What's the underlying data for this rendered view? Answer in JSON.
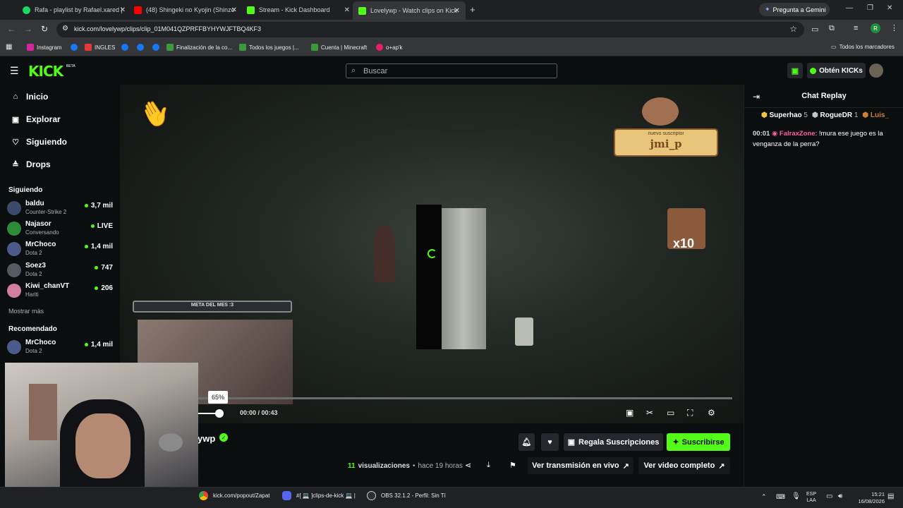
{
  "browser": {
    "tabs": [
      {
        "title": "Rafa - playlist by Rafael.xared |",
        "color": "#1ed760"
      },
      {
        "title": "(48) Shingeki no Kyojin (Shinzo",
        "color": "#ff0000"
      },
      {
        "title": "Stream - Kick Dashboard",
        "color": "#53fc18"
      },
      {
        "title": "Lovelywp - Watch clips on Kick",
        "color": "#53fc18"
      }
    ],
    "gemini_label": "Pregunta a Gemini",
    "url": "kick.com/lovelywp/clips/clip_01M041QZPRFFBYHYWJFTBQ4KF3",
    "bookmarks": [
      "Instagram",
      "",
      "INGLES",
      "",
      "",
      "",
      "Finalización de la co...",
      "Todos los juegos |...",
      "Cuenta | Minecraft",
      "o+ap'k"
    ],
    "all_bookmarks": "Todos los marcadores"
  },
  "header": {
    "logo": "KICK",
    "beta": "BETA",
    "search_placeholder": "Buscar",
    "get_kicks": "Obtén KICKs"
  },
  "sidebar": {
    "nav": [
      {
        "label": "Inicio",
        "icon": "⌂"
      },
      {
        "label": "Explorar",
        "icon": "▣"
      },
      {
        "label": "Siguiendo",
        "icon": "♡"
      },
      {
        "label": "Drops",
        "icon": "≜"
      }
    ],
    "following_title": "Siguiendo",
    "following": [
      {
        "name": "baldu",
        "game": "Counter-Strike 2",
        "viewers": "3,7 mil",
        "color": "#3b4a6b"
      },
      {
        "name": "Najasor",
        "game": "Conversando",
        "viewers": "LIVE",
        "color": "#2e8b3a"
      },
      {
        "name": "MrChoco",
        "game": "Dota 2",
        "viewers": "1,4 mil",
        "color": "#4a5a8a"
      },
      {
        "name": "Soez3",
        "game": "Dota 2",
        "viewers": "747",
        "color": "#555a60"
      },
      {
        "name": "Kiwi_chanVT",
        "game": "Hariti",
        "viewers": "206",
        "color": "#d17ea0"
      }
    ],
    "show_more": "Mostrar más",
    "recommended_title": "Recomendado",
    "recommended": [
      {
        "name": "MrChoco",
        "game": "Dota 2",
        "viewers": "1,4 mil",
        "color": "#4a5a8a"
      }
    ]
  },
  "video": {
    "goal_text": "META DEL MES :3",
    "sub_text": "nuevo suscriptor",
    "sub_name": "jmi_p",
    "multiplier": "x10",
    "tooltip": "65%",
    "time": "00:00 / 00:43",
    "progress": 0.0
  },
  "channel": {
    "name_suffix": "ywp",
    "views_count": "11",
    "views_label": "visualizaciones",
    "time_ago": "hace 19 horas",
    "gift_subs": "Regala Suscripciones",
    "subscribe": "Suscribirse",
    "watch_live": "Ver transmisión en vivo",
    "watch_full": "Ver video completo"
  },
  "chat": {
    "title": "Chat Replay",
    "top_gifters": [
      {
        "name": "Superhao",
        "count": "5",
        "color": "#f5c542"
      },
      {
        "name": "RogueDR",
        "count": "1",
        "color": "#c0c4c8"
      },
      {
        "name": "Luis_",
        "count": "",
        "color": "#cd7f32"
      }
    ],
    "messages": [
      {
        "time": "00:01",
        "user": "FalraxZone",
        "user_color": "#ff5fa2",
        "text": "!mura ese juego es la venganza de la perra?"
      }
    ]
  },
  "taskbar": {
    "apps": [
      {
        "label": "kick.com/popout/Zapat"
      },
      {
        "label": "#[ 💻 ]clips-de-kick 💻 |"
      },
      {
        "label": "OBS 32.1.2 - Perfil: Sin Tí"
      }
    ],
    "lang": "ESP",
    "lang2": "LAA",
    "clock_time": "15:21",
    "clock_date": "16/08/2026"
  },
  "colors": {
    "accent": "#53fc18",
    "bg": "#0b0e0f",
    "button": "#24272c"
  }
}
